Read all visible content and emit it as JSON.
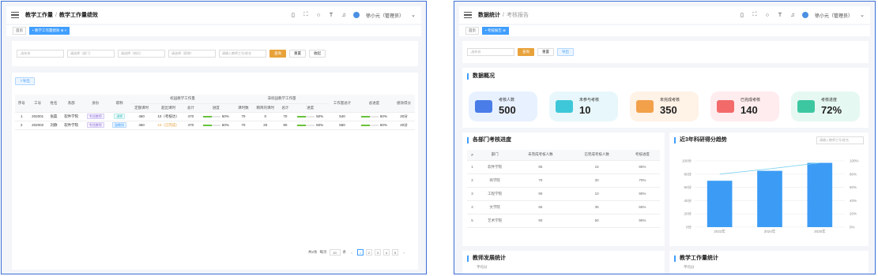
{
  "left": {
    "breadcrumb": {
      "parent": "教学工作量",
      "sep": "/",
      "current": "教学工作量绩效"
    },
    "user": "徐小元（管理员）",
    "tabs": [
      {
        "label": "首页"
      },
      {
        "label": "• 教学工作量绩效 ⊗ ×"
      }
    ],
    "filters": {
      "date_placeholder": "选年份",
      "dept_placeholder": "请选择（部门）",
      "pos_placeholder": "请选择（岗位）",
      "title_placeholder": "请选择（职称）",
      "search_placeholder": "请输入教师工号/姓名",
      "query": "查询",
      "reset": "重置",
      "collapse": "收起"
    },
    "export_label": "导出",
    "table": {
      "group_headers": {
        "inside": "校园教学工作量",
        "outside": "非校园教学工作量"
      },
      "headers": [
        "序号",
        "工号",
        "姓名",
        "系部",
        "身份",
        "职称",
        "定额课时",
        "超出课时",
        "总计",
        "进度",
        "课时数",
        "精简的课时",
        "总计",
        "进度",
        "工作量总计",
        "总进度",
        "绩效得分"
      ],
      "rows": [
        {
          "idx": "1",
          "id": "202001",
          "name": "张磊",
          "dept": "软件学院",
          "role": "专任教师",
          "title": "讲师",
          "quota": "460",
          "extra": "10（考核达）",
          "total1": "470",
          "prog1": "50%",
          "p1": 50,
          "hours": "70",
          "reduced": "0",
          "total2": "70",
          "prog2": "50%",
          "p2": 50,
          "sum": "540",
          "progAll": "50%",
          "pAll": 50,
          "score": "20分"
        },
        {
          "idx": "2",
          "id": "202002",
          "name": "刘静",
          "dept": "软件学院",
          "role": "专任教师",
          "title": "副教授",
          "quota": "460",
          "extra": "10（已完成）",
          "total1": "470",
          "prog1": "50%",
          "p1": 50,
          "hours": "70",
          "reduced": "20",
          "total2": "90",
          "prog2": "50%",
          "p2": 50,
          "sum": "560",
          "progAll": "50%",
          "pAll": 50,
          "score": "20分"
        }
      ]
    },
    "pager": {
      "total": "共2条",
      "size_label": "每页",
      "size": "10",
      "size_unit": "条",
      "pages": [
        "1",
        "2",
        "3",
        "4",
        "5"
      ]
    }
  },
  "right": {
    "breadcrumb": {
      "parent": "数据统计",
      "sep": "/",
      "current": "考核报告"
    },
    "user": "徐小元（管理员）",
    "tabs": [
      {
        "label": "首页"
      },
      {
        "label": "• 考核报告 ⊗"
      }
    ],
    "filters": {
      "date_placeholder": "选年份",
      "query": "查询",
      "reset": "重置",
      "export": "导出"
    },
    "overview_title": "数据概况",
    "cards": [
      {
        "label": "考核人数",
        "value": "500",
        "bg": "#e8f1ff",
        "color": "#4a7de8"
      },
      {
        "label": "未参与考核",
        "value": "10",
        "bg": "#e8f7fb",
        "color": "#3ec7d8"
      },
      {
        "label": "未完成考核",
        "value": "350",
        "bg": "#fff2e6",
        "color": "#f2a04a"
      },
      {
        "label": "已完成考核",
        "value": "140",
        "bg": "#ffecee",
        "color": "#f26a6a"
      },
      {
        "label": "考核进度",
        "value": "72%",
        "bg": "#e6f8f2",
        "color": "#3cc7a0"
      }
    ],
    "dept_title": "各部门考核进度",
    "dept_headers": [
      "#",
      "部门",
      "未完成考核人数",
      "已完成考核人数",
      "考核进度"
    ],
    "dept_rows": [
      [
        "1",
        "软件学院",
        "85",
        "15",
        "85%"
      ],
      [
        "2",
        "商学院",
        "70",
        "30",
        "70%"
      ],
      [
        "3",
        "工程学院",
        "90",
        "10",
        "90%"
      ],
      [
        "4",
        "文学院",
        "65",
        "35",
        "65%"
      ],
      [
        "5",
        "艺术学院",
        "90",
        "50",
        "90%"
      ]
    ],
    "trend_title": "近3年科研得分趋势",
    "trend_search": "请输入教师工号/姓名",
    "teacher_dev_title": "教师发展统计",
    "teacher_dev_sub": "平均分",
    "workload_title": "教学工作量统计",
    "workload_sub": "平均分",
    "chart_data": {
      "type": "bar",
      "categories": [
        "2022年",
        "2024年",
        "2025年"
      ],
      "series": [
        {
          "values": [
            70,
            85,
            97
          ],
          "color": "#3c9cf5"
        }
      ],
      "line": {
        "values": [
          80,
          88,
          97
        ],
        "color": "#7fd3f0"
      },
      "yticks": [
        "0分",
        "20分",
        "40分",
        "60分",
        "80分",
        "100分"
      ],
      "y2ticks": [
        "0%",
        "20%",
        "40%",
        "60%",
        "80%",
        "100%"
      ],
      "ylim": [
        0,
        100
      ]
    }
  }
}
